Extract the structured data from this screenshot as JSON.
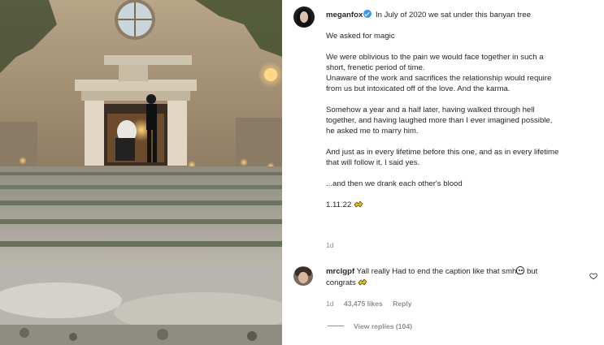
{
  "post": {
    "username": "meganfox",
    "caption_lines": [
      " In July of 2020 we sat under this banyan tree",
      "We asked for magic",
      "We were oblivious to the pain we would face together in such a",
      "short, frenetic period of time.",
      "Unaware of the work and sacrifices the relationship would require",
      "from us but intoxicated off of the love. And the karma.",
      "Somehow a year and a half later, having walked through hell",
      "together, and having laughed more than I ever imagined possible,",
      "he asked me to marry him.",
      "And just as in every lifetime before this one, and as in every lifetime",
      "that will follow it, I said yes.",
      "...and then we drank each other's blood",
      "1.11.22 "
    ],
    "time_ago": "1d",
    "verified_icon": "verified-badge-icon",
    "verified_color": "#3897f0"
  },
  "comment": {
    "username": "mrclgpf",
    "text": " Yall really Had to end the caption like that smh",
    "text_after": " but",
    "text_line2": "congrats ",
    "time_ago": "1d",
    "likes": "43,475 likes",
    "reply_label": "Reply",
    "view_replies": "View replies (104)"
  },
  "colors": {
    "muted": "#8e8e8e",
    "text": "#262626"
  }
}
